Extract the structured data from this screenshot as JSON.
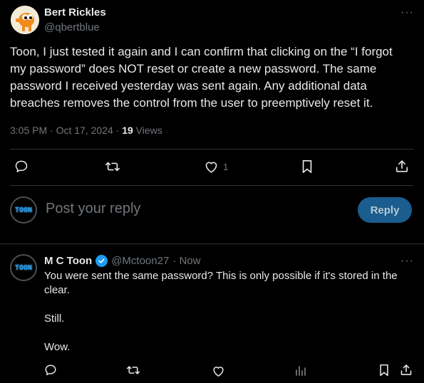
{
  "tweet": {
    "author_name": "Bert Rickles",
    "author_handle": "@qbertblue",
    "text": "Toon, I just tested it again and I can confirm that clicking on the “I forgot my password” does NOT reset or create a new password. The same password I received yesterday was sent again. Any additional data breaches removes the control from the user to preemptively reset it.",
    "time": "3:05 PM · Oct 17, 2024 · ",
    "views_count": "19",
    "views_label": " Views",
    "like_count": "1",
    "more_label": "···"
  },
  "composer": {
    "avatar_text": "TOON",
    "placeholder": "Post your reply",
    "reply_button": "Reply"
  },
  "reply": {
    "avatar_text": "TOON",
    "author_name": "M C Toon",
    "author_handle": "@Mctoon27",
    "time": "· Now",
    "more_label": "···",
    "lines": [
      "You were sent the same password?  This is only possible if it's stored in the clear.",
      "Still.",
      "Wow."
    ]
  },
  "colors": {
    "background": "#000000",
    "text": "#e7e9ea",
    "muted": "#71767b",
    "accent": "#1d9bf0",
    "reply_button_bg": "#1a5d8e"
  }
}
